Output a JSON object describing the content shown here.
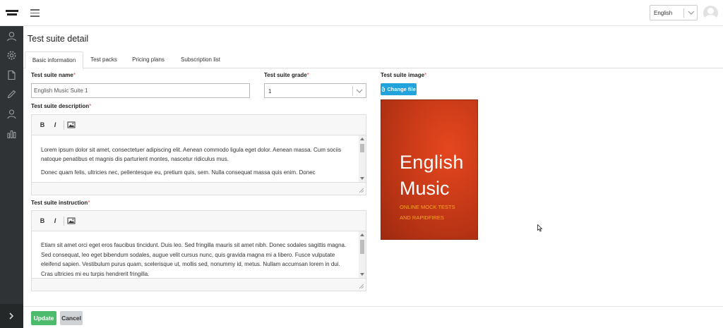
{
  "header": {
    "logo_text": "TIBLINE HE",
    "language": "English"
  },
  "page": {
    "title": "Test suite detail"
  },
  "tabs": [
    {
      "label": "Basic information",
      "active": true
    },
    {
      "label": "Test packs",
      "active": false
    },
    {
      "label": "Pricing plans",
      "active": false
    },
    {
      "label": "Subscription list",
      "active": false
    }
  ],
  "form": {
    "name_label": "Test suite name",
    "name_value": "English Music Suite 1",
    "grade_label": "Test suite grade",
    "grade_value": "1",
    "image_label": "Test suite image",
    "change_file_label": "Change file",
    "required_mark": "*",
    "description_label": "Test suite description",
    "description_paragraphs": [
      "Lorem ipsum dolor sit amet, consectetuer adipiscing elit. Aenean commodo ligula eget dolor. Aenean massa. Cum sociis natoque penatibus et magnis dis parturient montes, nascetur ridiculus mus.",
      "Donec quam felis, ultricies nec, pellentesque eu, pretium quis, sem. Nulla consequat massa quis enim. Donec"
    ],
    "instruction_label": "Test suite instruction",
    "instruction_paragraphs": [
      "Etiam sit amet orci eget eros faucibus tincidunt. Duis leo. Sed fringilla mauris sit amet nibh. Donec sodales sagittis magna. Sed consequat, leo eget bibendum sodales, augue velit cursus nunc, quis gravida magna mi a libero. Fusce vulputate eleifend sapien. Vestibulum purus quam, scelerisque ut, mollis sed, nonummy id, metus. Nullam accumsan lorem in dui. Cras ultricies mi eu turpis hendrerit fringilla."
    ],
    "toolbar": {
      "bold": "B",
      "italic": "I"
    }
  },
  "cover": {
    "title_line1": "English",
    "title_line2": "Music",
    "subtitle_line1": "ONLINE MOCK TESTS",
    "subtitle_line2": "AND RAPIDFIRES"
  },
  "footer": {
    "update_label": "Update",
    "cancel_label": "Cancel"
  },
  "colors": {
    "accent_blue": "#23a3dc",
    "update_green": "#4cbb6c",
    "required_red": "#d9534f",
    "sidebar_bg": "#2f3336"
  }
}
